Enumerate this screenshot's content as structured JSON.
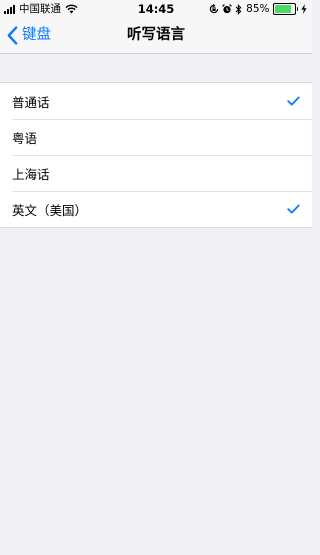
{
  "status_bar": {
    "carrier": "中国联通",
    "time": "14:45",
    "battery_percent": "85%",
    "battery_level": 0.85,
    "battery_color": "#4cd964"
  },
  "nav": {
    "back_label": "键盘",
    "title": "听写语言",
    "accent_color": "#0a7aff"
  },
  "languages": {
    "items": [
      {
        "label": "普通话",
        "checked": true
      },
      {
        "label": "粤语",
        "checked": false
      },
      {
        "label": "上海话",
        "checked": false
      },
      {
        "label": "英文（美国）",
        "checked": true
      }
    ]
  },
  "icons": [
    "signal-icon",
    "wifi-icon",
    "lock-rotation-icon",
    "alarm-icon",
    "bluetooth-icon",
    "battery-icon",
    "charging-icon",
    "chevron-left-icon",
    "checkmark-icon"
  ]
}
